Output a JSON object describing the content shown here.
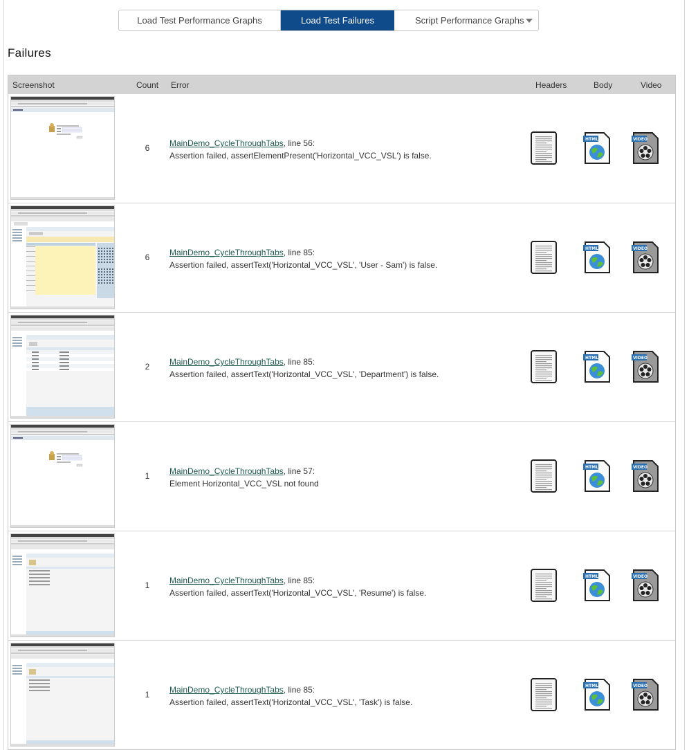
{
  "tabs": [
    {
      "label": "Load Test Performance Graphs",
      "active": false
    },
    {
      "label": "Load Test Failures",
      "active": true
    },
    {
      "label": "Script Performance Graphs",
      "active": false
    }
  ],
  "page_title": "Failures",
  "table": {
    "headers": {
      "screenshot": "Screenshot",
      "count": "Count",
      "error": "Error",
      "headers": "Headers",
      "body": "Body",
      "video": "Video"
    },
    "rows": [
      {
        "count": "6",
        "link": "MainDemo_CycleThroughTabs",
        "line": ", line 56:",
        "message": "Assertion failed, assertElementPresent('Horizontal_VCC_VSL') is false.",
        "thumb": "login"
      },
      {
        "count": "6",
        "link": "MainDemo_CycleThroughTabs",
        "line": ", line 85:",
        "message": "Assertion failed, assertText('Horizontal_VCC_VSL', 'User - Sam') is false.",
        "thumb": "calendar"
      },
      {
        "count": "2",
        "link": "MainDemo_CycleThroughTabs",
        "line": ", line 85:",
        "message": "Assertion failed, assertText('Horizontal_VCC_VSL', 'Department') is false.",
        "thumb": "list"
      },
      {
        "count": "1",
        "link": "MainDemo_CycleThroughTabs",
        "line": ", line 57:",
        "message": "Element Horizontal_VCC_VSL not found",
        "thumb": "login"
      },
      {
        "count": "1",
        "link": "MainDemo_CycleThroughTabs",
        "line": ", line 85:",
        "message": "Assertion failed, assertText('Horizontal_VCC_VSL', 'Resume') is false.",
        "thumb": "form"
      },
      {
        "count": "1",
        "link": "MainDemo_CycleThroughTabs",
        "line": ", line 85:",
        "message": "Assertion failed, assertText('Horizontal_VCC_VSL', 'Task') is false.",
        "thumb": "form2"
      }
    ]
  },
  "icons": {
    "headers": "document-icon",
    "body": "html-globe-icon",
    "video": "video-film-icon"
  },
  "colors": {
    "active_tab": "#0f4b8a",
    "header_bg": "#d3d3d3",
    "link": "#1e5a4e"
  }
}
